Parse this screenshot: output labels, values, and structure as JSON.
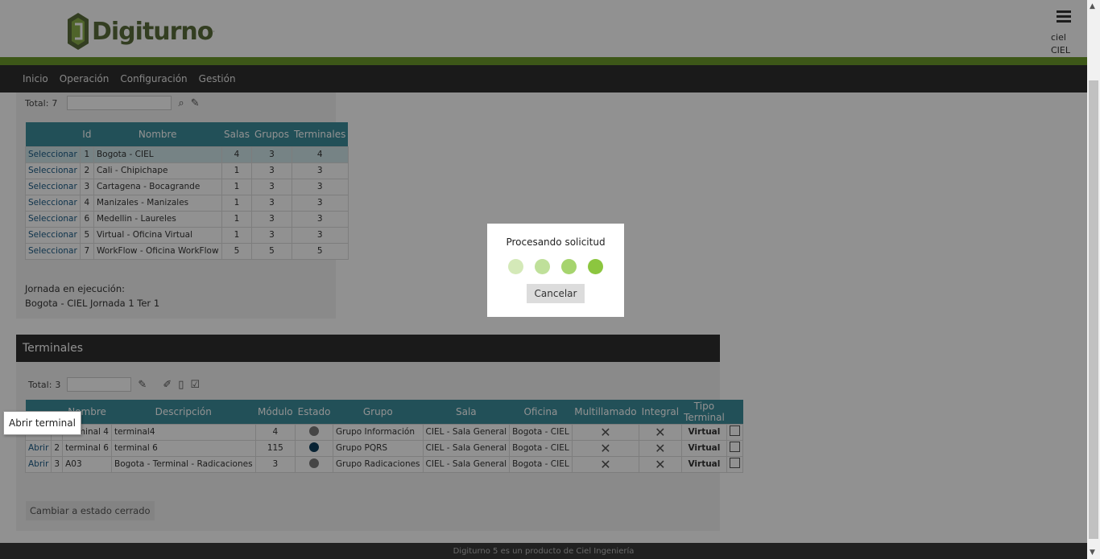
{
  "header": {
    "brand": "Digiturno",
    "brand_mark": "·",
    "user_name": "ciel",
    "user_org": "CIEL"
  },
  "nav": {
    "items": [
      "Inicio",
      "Operación",
      "Configuración",
      "Gestión"
    ]
  },
  "oficinas": {
    "total_label": "Total:",
    "total_value": "7",
    "columns": [
      "",
      "Id",
      "Nombre",
      "Salas",
      "Grupos",
      "Terminales"
    ],
    "rows": [
      {
        "action": "Seleccionar",
        "id": "1",
        "nombre": "Bogota - CIEL",
        "salas": "4",
        "grupos": "3",
        "terminales": "4",
        "selected": true
      },
      {
        "action": "Seleccionar",
        "id": "2",
        "nombre": "Cali - Chipichape",
        "salas": "1",
        "grupos": "3",
        "terminales": "3"
      },
      {
        "action": "Seleccionar",
        "id": "3",
        "nombre": "Cartagena - Bocagrande",
        "salas": "1",
        "grupos": "3",
        "terminales": "3"
      },
      {
        "action": "Seleccionar",
        "id": "4",
        "nombre": "Manizales - Manizales",
        "salas": "1",
        "grupos": "3",
        "terminales": "3"
      },
      {
        "action": "Seleccionar",
        "id": "6",
        "nombre": "Medellin - Laureles",
        "salas": "1",
        "grupos": "3",
        "terminales": "3"
      },
      {
        "action": "Seleccionar",
        "id": "5",
        "nombre": "Virtual - Oficina Virtual",
        "salas": "1",
        "grupos": "3",
        "terminales": "3"
      },
      {
        "action": "Seleccionar",
        "id": "7",
        "nombre": "WorkFlow - Oficina WorkFlow",
        "salas": "5",
        "grupos": "5",
        "terminales": "5"
      }
    ],
    "jornada_label": "Jornada en ejecución:",
    "jornada_value": "Bogota - CIEL Jornada 1 Ter 1"
  },
  "terminales": {
    "title": "Terminales",
    "total_label": "Total:",
    "total_value": "3",
    "columns": [
      "",
      "",
      "Nombre",
      "Descripción",
      "Módulo",
      "Estado",
      "Grupo",
      "Sala",
      "Oficina",
      "Multillamado",
      "Integral",
      "Tipo Terminal",
      ""
    ],
    "rows": [
      {
        "action": "Abrir",
        "num": "1",
        "nombre": "terminal 4",
        "descripcion": "terminal4",
        "modulo": "4",
        "estado_color": "#7a7a7a",
        "grupo": "Grupo Información",
        "sala": "CIEL - Sala General",
        "oficina": "Bogota - CIEL",
        "multillamado": "✕",
        "integral": "✕",
        "tipo": "Virtual"
      },
      {
        "action": "Abrir",
        "num": "2",
        "nombre": "terminal 6",
        "descripcion": "terminal 6",
        "modulo": "115",
        "estado_color": "#0d3d5a",
        "grupo": "Grupo PQRS",
        "sala": "CIEL - Sala General",
        "oficina": "Bogota - CIEL",
        "multillamado": "✕",
        "integral": "✕",
        "tipo": "Virtual"
      },
      {
        "action": "Abrir",
        "num": "3",
        "nombre": "A03",
        "descripcion": "Bogota - Terminal - Radicaciones",
        "modulo": "3",
        "estado_color": "#7a7a7a",
        "grupo": "Grupo Radicaciones",
        "sala": "CIEL - Sala General",
        "oficina": "Bogota - CIEL",
        "multillamado": "✕",
        "integral": "✕",
        "tipo": "Virtual"
      }
    ],
    "cambiar_button": "Cambiar a estado cerrado"
  },
  "tooltip": "Abrir terminal",
  "modal": {
    "title": "Procesando solicitud",
    "cancel_button": "Cancelar",
    "spinner_colors": [
      "#d4e9b8",
      "#bfe09a",
      "#a6d46e",
      "#8cc63f"
    ]
  },
  "footer": "Digiturno 5 es un producto de Ciel Ingeniería",
  "colors": {
    "accent_green": "#6b9a2b",
    "table_header": "#3c8e9c",
    "nav_dark": "#2e2e2e"
  }
}
